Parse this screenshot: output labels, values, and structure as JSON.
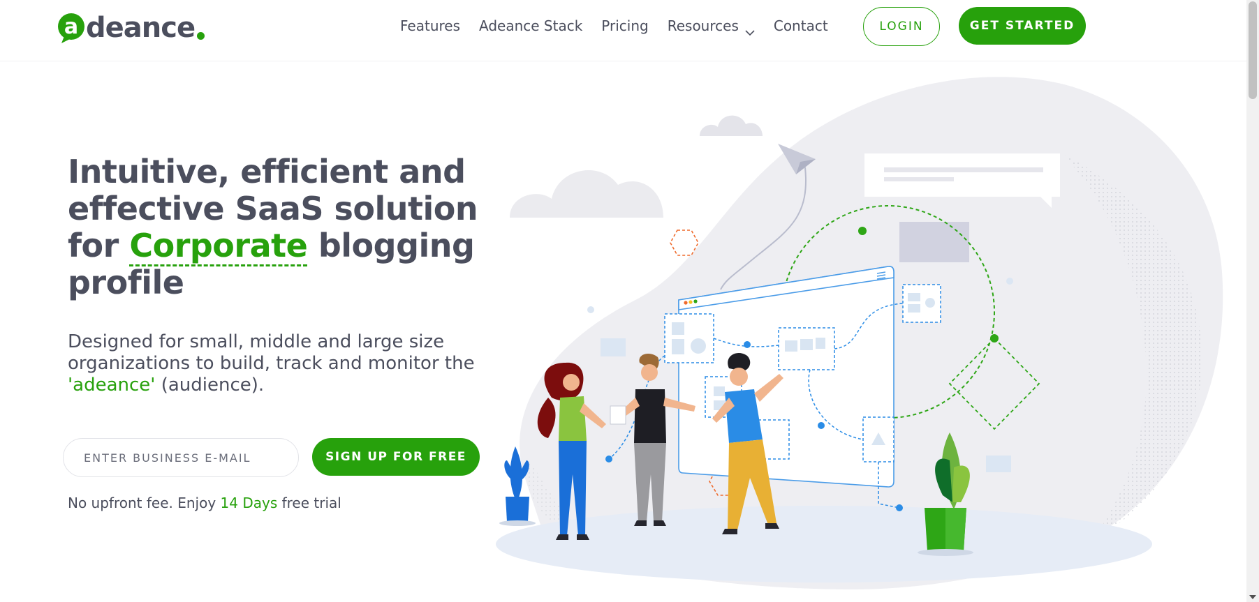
{
  "brand": {
    "logo_text": "deance",
    "accent_color": "#27a10c",
    "text_color": "#4b4e5d"
  },
  "nav": {
    "items": [
      {
        "label": "Features"
      },
      {
        "label": "Adeance Stack"
      },
      {
        "label": "Pricing"
      },
      {
        "label": "Resources",
        "has_dropdown": true
      },
      {
        "label": "Contact"
      }
    ],
    "login_label": "LOGIN",
    "get_started_label": "GET STARTED"
  },
  "hero": {
    "headline_part1": "Intuitive, efficient and effective SaaS solution for ",
    "headline_highlight": "Corporate",
    "headline_part2": " blogging profile",
    "subtext_part1": "Designed for small, middle and large size organizations to build, track and monitor the ",
    "subtext_highlight": "'adeance'",
    "subtext_part2": " (audience).",
    "email_placeholder": "ENTER BUSINESS E-MAIL",
    "signup_label": "SIGN UP FOR FREE",
    "trial_part1": "No upfront fee. Enjoy ",
    "trial_highlight": "14 Days",
    "trial_part2": " free trial"
  }
}
